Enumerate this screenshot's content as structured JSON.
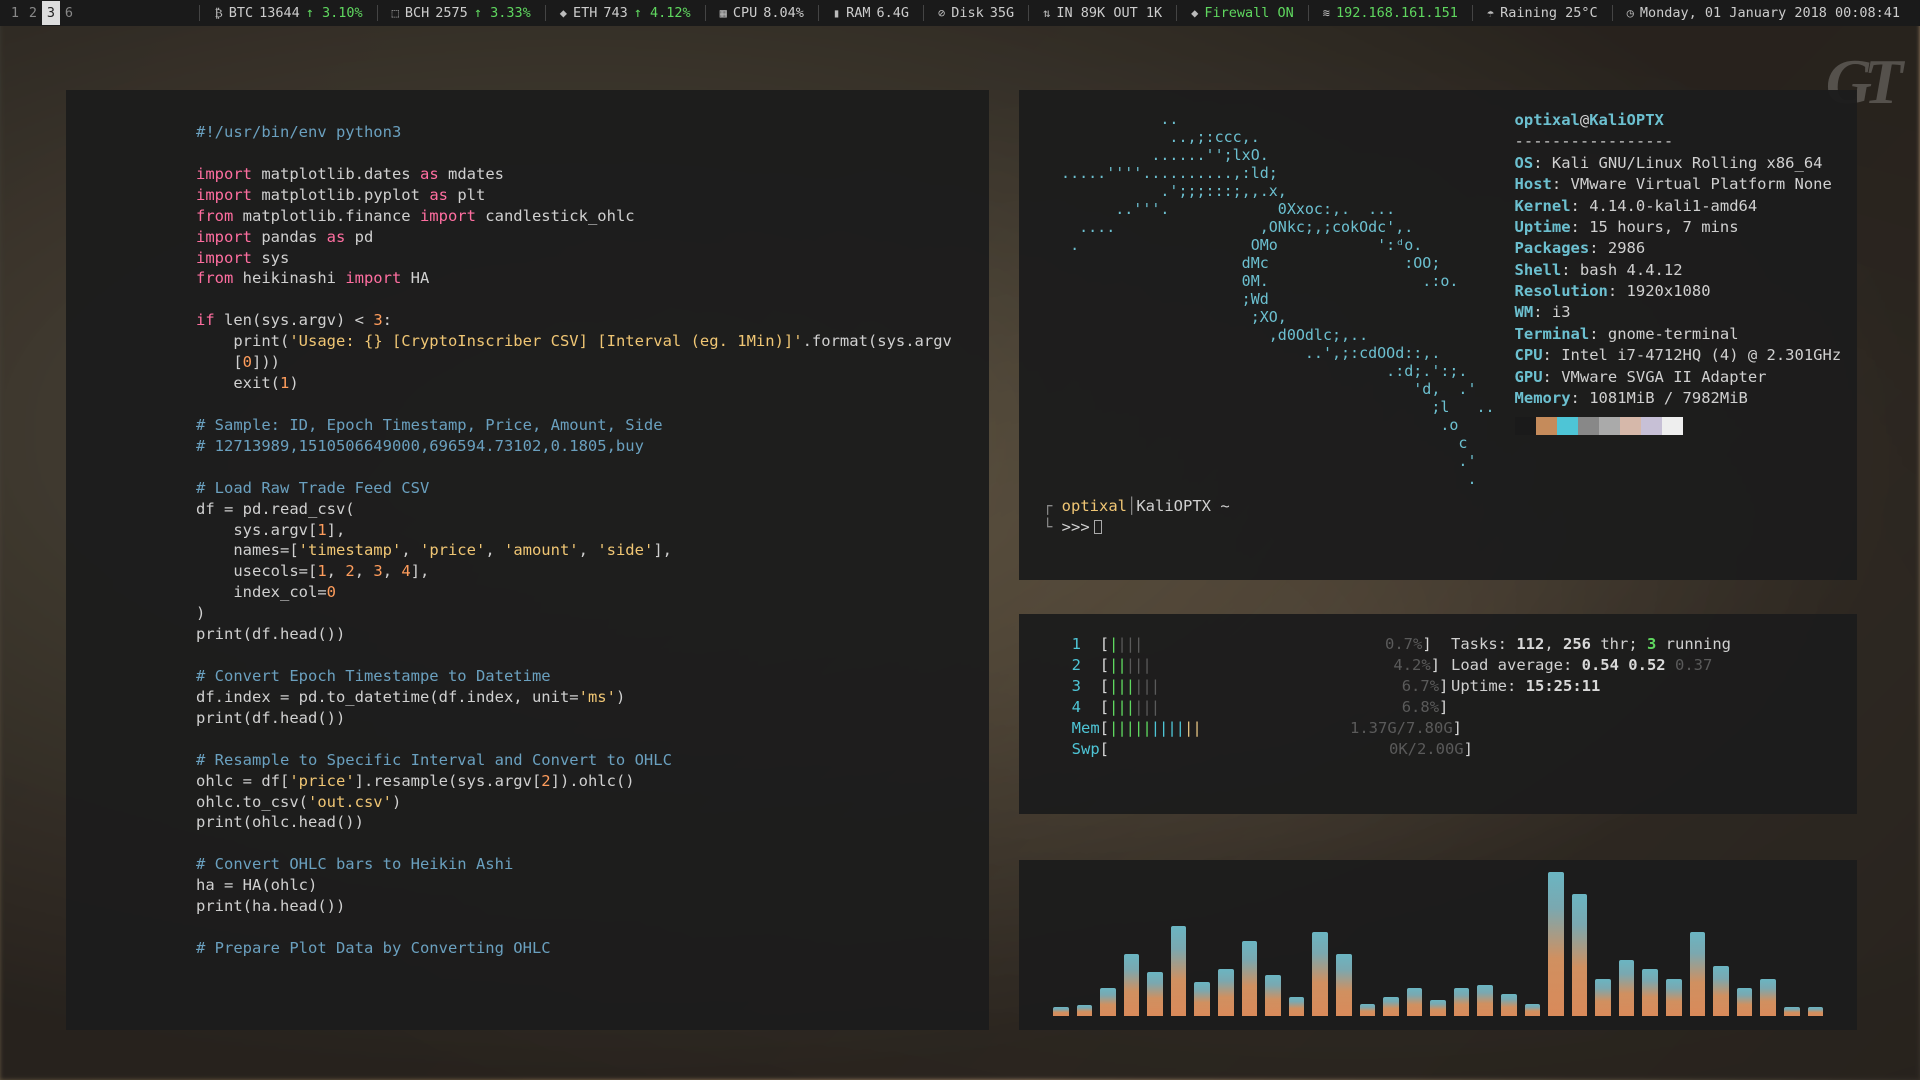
{
  "topbar": {
    "workspaces": [
      "1",
      "2",
      "3",
      "6"
    ],
    "active_workspace": "3",
    "btc": {
      "sym": "₿",
      "label": "BTC",
      "value": "13644",
      "delta": "↑ 3.10%"
    },
    "bch": {
      "sym": "⬚",
      "label": "BCH",
      "value": "2575",
      "delta": "↑ 3.33%"
    },
    "eth": {
      "sym": "◆",
      "label": "ETH",
      "value": "743",
      "delta": "↑ 4.12%"
    },
    "cpu": {
      "sym": "▦",
      "label": "CPU",
      "value": "8.04%"
    },
    "ram": {
      "sym": "▮",
      "label": "RAM",
      "value": "6.4G"
    },
    "disk": {
      "sym": "⊘",
      "label": "Disk",
      "value": "35G"
    },
    "net": {
      "sym": "⇅",
      "label": "IN 89K OUT 1K"
    },
    "fw": {
      "sym": "◆",
      "label": "Firewall ON"
    },
    "ip": {
      "sym": "≋",
      "label": "192.168.161.151"
    },
    "weather": {
      "sym": "☂",
      "label": "Raining 25°C"
    },
    "clock": {
      "sym": "◷",
      "label": "Monday, 01 January 2018 00:08:41"
    }
  },
  "editor": {
    "lines": [
      {
        "t": "shebang",
        "text": "#!/usr/bin/env python3"
      },
      {
        "t": "blank"
      },
      {
        "t": "import",
        "kw": "import",
        "mod": "matplotlib.dates",
        "as": "as",
        "alias": "mdates"
      },
      {
        "t": "import",
        "kw": "import",
        "mod": "matplotlib.pyplot",
        "as": "as",
        "alias": "plt"
      },
      {
        "t": "from",
        "kw": "from",
        "mod": "matplotlib.finance",
        "imp": "import",
        "name": "candlestick_ohlc"
      },
      {
        "t": "import",
        "kw": "import",
        "mod": "pandas",
        "as": "as",
        "alias": "pd"
      },
      {
        "t": "import_simple",
        "kw": "import",
        "mod": "sys"
      },
      {
        "t": "from",
        "kw": "from",
        "mod": "heikinashi",
        "imp": "import",
        "name": "HA"
      },
      {
        "t": "blank"
      },
      {
        "t": "raw",
        "html": "<span class=py-k>if</span> len(sys.argv) &lt; <span class=py-n>3</span>:"
      },
      {
        "t": "raw",
        "html": "    print(<span class=py-s>'Usage: {} [CryptoInscriber CSV] [Interval (eg. 1Min)]'</span>.format(sys.argv"
      },
      {
        "t": "raw",
        "html": "    [<span class=py-n>0</span>]))"
      },
      {
        "t": "raw",
        "html": "    exit(<span class=py-n>1</span>)"
      },
      {
        "t": "blank"
      },
      {
        "t": "comment",
        "text": "# Sample: ID, Epoch Timestamp, Price, Amount, Side"
      },
      {
        "t": "comment",
        "text": "# 12713989,1510506649000,696594.73102,0.1805,buy"
      },
      {
        "t": "blank"
      },
      {
        "t": "comment",
        "text": "# Load Raw Trade Feed CSV"
      },
      {
        "t": "raw",
        "html": "df = pd.read_csv("
      },
      {
        "t": "raw",
        "html": "    sys.argv[<span class=py-n>1</span>],"
      },
      {
        "t": "raw",
        "html": "    names=[<span class=py-s>'timestamp'</span>, <span class=py-s>'price'</span>, <span class=py-s>'amount'</span>, <span class=py-s>'side'</span>],"
      },
      {
        "t": "raw",
        "html": "    usecols=[<span class=py-n>1</span>, <span class=py-n>2</span>, <span class=py-n>3</span>, <span class=py-n>4</span>],"
      },
      {
        "t": "raw",
        "html": "    index_col=<span class=py-n>0</span>"
      },
      {
        "t": "raw",
        "html": ")"
      },
      {
        "t": "raw",
        "html": "print(df.head())"
      },
      {
        "t": "blank"
      },
      {
        "t": "comment",
        "text": "# Convert Epoch Timestampe to Datetime"
      },
      {
        "t": "raw",
        "html": "df.index = pd.to_datetime(df.index, unit=<span class=py-s>'ms'</span>)"
      },
      {
        "t": "raw",
        "html": "print(df.head())"
      },
      {
        "t": "blank"
      },
      {
        "t": "comment",
        "text": "# Resample to Specific Interval and Convert to OHLC"
      },
      {
        "t": "raw",
        "html": "ohlc = df[<span class=py-s>'price'</span>].resample(sys.argv[<span class=py-n>2</span>]).ohlc()"
      },
      {
        "t": "raw",
        "html": "ohlc.to_csv(<span class=py-s>'out.csv'</span>)"
      },
      {
        "t": "raw",
        "html": "print(ohlc.head())"
      },
      {
        "t": "blank"
      },
      {
        "t": "comment",
        "text": "# Convert OHLC bars to Heikin Ashi"
      },
      {
        "t": "raw",
        "html": "ha = HA(ohlc)"
      },
      {
        "t": "raw",
        "html": "print(ha.head())"
      },
      {
        "t": "blank"
      },
      {
        "t": "comment",
        "text": "# Prepare Plot Data by Converting OHLC"
      }
    ]
  },
  "neofetch": {
    "user": "optixal",
    "host": "KaliOPTX",
    "art": "             ..\n              ..,;:ccc,.\n            ......'';lxO.\n  .....''''..........,:ld;\n             .';;;:::;,,.x,\n        ..'''.            0Xxoc:,.  ...\n    ....                ,ONkc;,;cokOdc',.\n   .                   OMo           ':ᵈo.\n                      dMc               :OO;\n                      0M.                 .:o.\n                      ;Wd\n                       ;XO,\n                         ,d0Odlc;,..\n                             ..',;:cdOOd::,.\n                                      .:d;.':;.\n                                         'd,  .'\n                                           ;l   ..\n                                            .o\n                                              c\n                                              .'\n                                               .",
    "info": [
      {
        "k": "OS",
        "v": "Kali GNU/Linux Rolling x86_64"
      },
      {
        "k": "Host",
        "v": "VMware Virtual Platform None"
      },
      {
        "k": "Kernel",
        "v": "4.14.0-kali1-amd64"
      },
      {
        "k": "Uptime",
        "v": "15 hours, 7 mins"
      },
      {
        "k": "Packages",
        "v": "2986"
      },
      {
        "k": "Shell",
        "v": "bash 4.4.12"
      },
      {
        "k": "Resolution",
        "v": "1920x1080"
      },
      {
        "k": "WM",
        "v": "i3"
      },
      {
        "k": "Terminal",
        "v": "gnome-terminal"
      },
      {
        "k": "CPU",
        "v": "Intel i7-4712HQ (4) @ 2.301GHz"
      },
      {
        "k": "GPU",
        "v": "VMware SVGA II Adapter"
      },
      {
        "k": "Memory",
        "v": "1081MiB / 7982MiB"
      }
    ],
    "swatches": [
      "#1a1a1a",
      "#c58b5b",
      "#4ec5d6",
      "#888888",
      "#aaaaaa",
      "#d6b8aa",
      "#c7c0d6",
      "#eeeeee"
    ],
    "prompt": {
      "user": "optixal",
      "host": "KaliOPTX",
      "path": "~",
      "ps": ">>>"
    }
  },
  "htop": {
    "cpus": [
      {
        "n": "1",
        "pct": "0.7%"
      },
      {
        "n": "2",
        "pct": "4.2%"
      },
      {
        "n": "3",
        "pct": "6.7%"
      },
      {
        "n": "4",
        "pct": "6.8%"
      }
    ],
    "mem": {
      "label": "Mem",
      "used": "1.37G",
      "total": "7.80G"
    },
    "swp": {
      "label": "Swp",
      "used": "0K",
      "total": "2.00G"
    },
    "tasks": {
      "label": "Tasks:",
      "procs": "112",
      "thr": "256",
      "thr_label": "thr;",
      "running": "3",
      "running_label": "running"
    },
    "load": {
      "label": "Load average:",
      "l1": "0.54",
      "l2": "0.52",
      "l3": "0.37"
    },
    "uptime": {
      "label": "Uptime:",
      "value": "15:25:11"
    }
  },
  "viz": {
    "bars": [
      6,
      7,
      18,
      40,
      28,
      58,
      22,
      30,
      48,
      26,
      12,
      54,
      40,
      8,
      12,
      18,
      10,
      18,
      20,
      14,
      8,
      92,
      78,
      24,
      36,
      30,
      24,
      54,
      32,
      18,
      24,
      6,
      6
    ]
  },
  "chart_data": {
    "type": "bar",
    "title": "Audio visualizer",
    "categories": [
      1,
      2,
      3,
      4,
      5,
      6,
      7,
      8,
      9,
      10,
      11,
      12,
      13,
      14,
      15,
      16,
      17,
      18,
      19,
      20,
      21,
      22,
      23,
      24,
      25,
      26,
      27,
      28,
      29,
      30,
      31,
      32,
      33
    ],
    "values": [
      6,
      7,
      18,
      40,
      28,
      58,
      22,
      30,
      48,
      26,
      12,
      54,
      40,
      8,
      12,
      18,
      10,
      18,
      20,
      14,
      8,
      92,
      78,
      24,
      36,
      30,
      24,
      54,
      32,
      18,
      24,
      6,
      6
    ],
    "ylim": [
      0,
      100
    ]
  }
}
